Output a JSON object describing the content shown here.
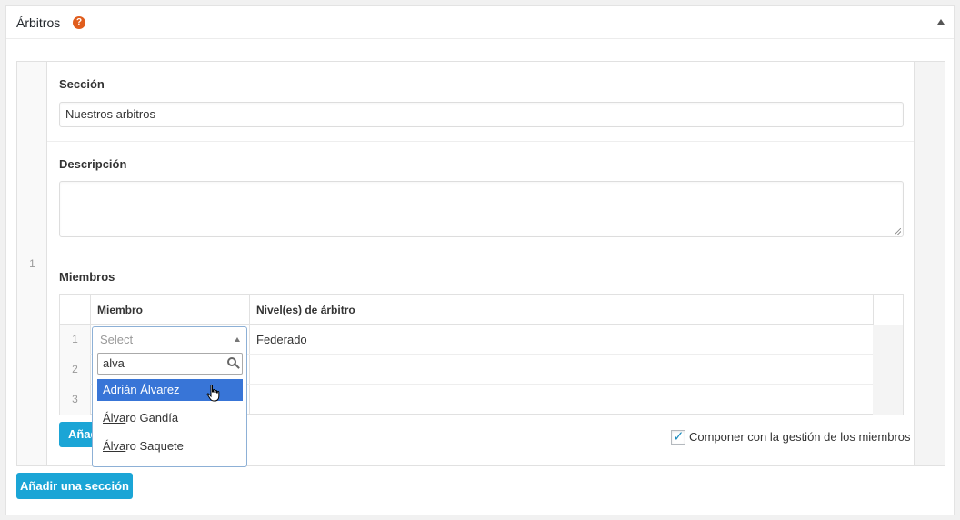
{
  "panel": {
    "title": "Árbitros",
    "help_icon": "question-circle-icon",
    "collapse_icon": "triangle-up-icon"
  },
  "section": {
    "row_number": "1",
    "section_label": "Sección",
    "section_value": "Nuestros arbitros",
    "description_label": "Descripción",
    "description_value": "",
    "members_label": "Miembros",
    "table": {
      "headers": [
        "Miembro",
        "Nivel(es) de árbitro"
      ],
      "rows": [
        {
          "index": "1",
          "level": "Federado"
        },
        {
          "index": "2",
          "level": ""
        },
        {
          "index": "3",
          "level": ""
        }
      ]
    },
    "select": {
      "placeholder": "Select",
      "search_value": "alva",
      "options": [
        {
          "prefix": "Adrián ",
          "match": "Álva",
          "suffix": "rez"
        },
        {
          "prefix": "",
          "match": "Álva",
          "suffix": "ro Gandía"
        },
        {
          "prefix": "",
          "match": "Álva",
          "suffix": "ro Saquete"
        }
      ]
    },
    "add_member_label_partial": "Añad",
    "compose_checkbox_label": "Componer con la gestión de los miembros",
    "compose_checked": true
  },
  "add_section_label": "Añadir una sección",
  "colors": {
    "accent": "#1ba5d6",
    "highlight": "#3875d7",
    "help": "#e05d1d"
  }
}
